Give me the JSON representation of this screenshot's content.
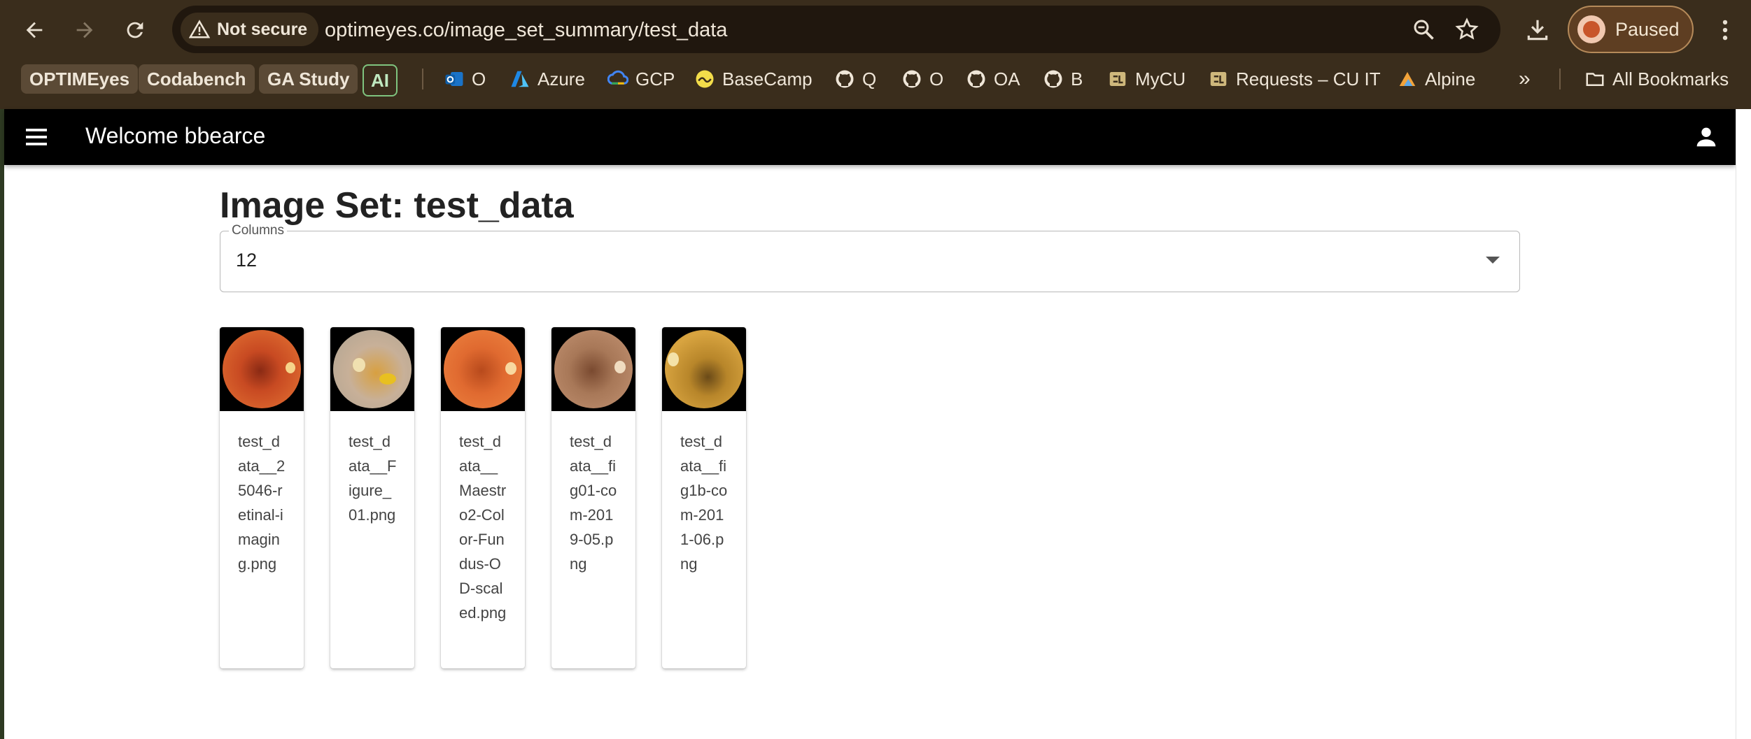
{
  "browser": {
    "security_label": "Not secure",
    "url": "optimeyes.co/image_set_summary/test_data",
    "profile_label": "Paused",
    "bookmarks": [
      {
        "label": "OPTIMEyes",
        "icon": "none"
      },
      {
        "label": "Codabench",
        "icon": "none"
      },
      {
        "label": "GA Study",
        "icon": "none"
      },
      {
        "label": "AI",
        "icon": "none"
      },
      {
        "label": "O",
        "icon": "outlook-icon"
      },
      {
        "label": "Azure",
        "icon": "azure-icon"
      },
      {
        "label": "GCP",
        "icon": "gcp-icon"
      },
      {
        "label": "BaseCamp",
        "icon": "basecamp-icon"
      },
      {
        "label": "Q",
        "icon": "github-icon"
      },
      {
        "label": "O",
        "icon": "github-icon"
      },
      {
        "label": "OA",
        "icon": "github-icon"
      },
      {
        "label": "B",
        "icon": "github-icon"
      },
      {
        "label": "MyCU",
        "icon": "cu-icon"
      },
      {
        "label": "Requests – CU IT",
        "icon": "cu-icon"
      },
      {
        "label": "Alpine",
        "icon": "alpine-icon"
      }
    ],
    "overflow_label": "»",
    "all_bookmarks_label": "All Bookmarks"
  },
  "appbar": {
    "welcome": "Welcome bbearce"
  },
  "main": {
    "title": "Image Set: test_data",
    "columns_select": {
      "label": "Columns",
      "value": "12"
    },
    "images": [
      {
        "caption": "test_data__25046-retinal-imaging.png",
        "style": "red"
      },
      {
        "caption": "test_data__Figure_01.png",
        "style": "pale"
      },
      {
        "caption": "test_data__Maestro2-Color-Fundus-OD-scaled.png",
        "style": "orange"
      },
      {
        "caption": "test_data__fig01-com-2019-05.png",
        "style": "brown"
      },
      {
        "caption": "test_data__fig1b-com-2011-06.png",
        "style": "gold"
      }
    ]
  },
  "colors": {
    "appbar": "#000000",
    "chrome": "#3a2d1c",
    "page": "#ffffff"
  }
}
